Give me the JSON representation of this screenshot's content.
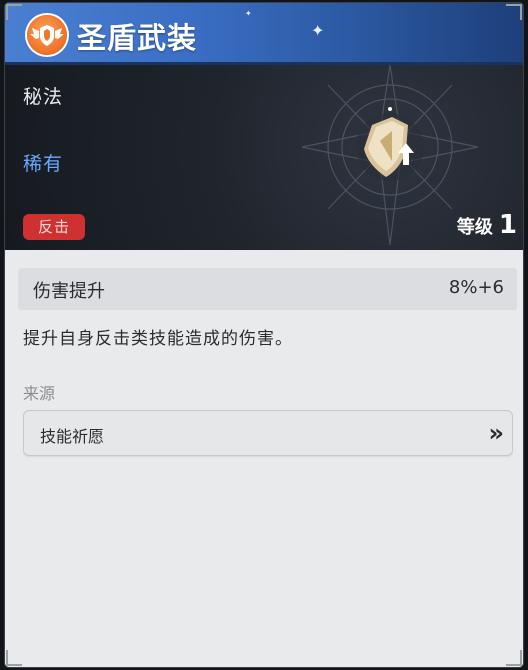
{
  "card": {
    "title": "圣盾武装",
    "category": "秘法",
    "rarity": "稀有",
    "tag": "反击",
    "level_label": "等级",
    "level_value": "1"
  },
  "stat": {
    "name": "伤害提升",
    "value": "8%+6"
  },
  "description": "提升自身反击类技能造成的伤害。",
  "source": {
    "label": "来源",
    "item_label": "技能祈愿",
    "arrow": "»"
  },
  "colors": {
    "header_blue": "#3b6fc5",
    "rarity_blue": "#6aa8ff",
    "tag_red": "#cf3030",
    "emblem_orange": "#f0762a"
  },
  "icons": {
    "emblem": "shield-wings-icon",
    "item": "gold-shield-icon",
    "chevron": "double-chevron-right-icon"
  }
}
